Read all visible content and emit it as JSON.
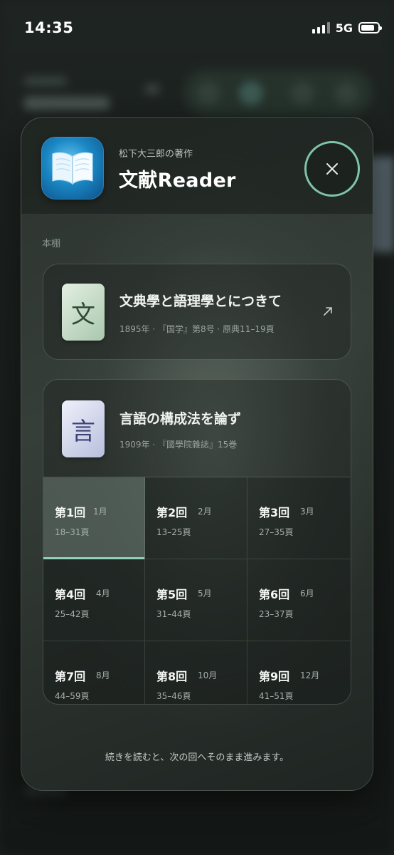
{
  "status_bar": {
    "time": "14:35",
    "network": "5G"
  },
  "modal": {
    "app_icon": "open-book-icon",
    "subtitle": "松下大三郎の著作",
    "title": "文献Reader",
    "close_icon": "close-icon",
    "section_label": "本棚",
    "accent_color": "#8fd3b6",
    "books": [
      {
        "thumb_char": "文",
        "title": "文典學と語理學とにつきて",
        "meta": "1895年 · 『国学』第8号 · 原典11–19頁",
        "link_icon": "external-link-icon"
      },
      {
        "thumb_char": "言",
        "title": "言語の構成法を論ず",
        "meta": "1909年 · 『國學院雜誌』15巻",
        "episodes": [
          {
            "name": "第1回",
            "month": "1月",
            "pages": "18–31頁",
            "active": true
          },
          {
            "name": "第2回",
            "month": "2月",
            "pages": "13–25頁"
          },
          {
            "name": "第3回",
            "month": "3月",
            "pages": "27–35頁"
          },
          {
            "name": "第4回",
            "month": "4月",
            "pages": "25–42頁"
          },
          {
            "name": "第5回",
            "month": "5月",
            "pages": "31–44頁"
          },
          {
            "name": "第6回",
            "month": "6月",
            "pages": "23–37頁"
          },
          {
            "name": "第7回",
            "month": "8月",
            "pages": "44–59頁"
          },
          {
            "name": "第8回",
            "month": "10月",
            "pages": "35–46頁"
          },
          {
            "name": "第9回",
            "month": "12月",
            "pages": "41–51頁"
          }
        ]
      }
    ],
    "footer_note": "続きを読むと、次の回へそのまま進みます。"
  }
}
